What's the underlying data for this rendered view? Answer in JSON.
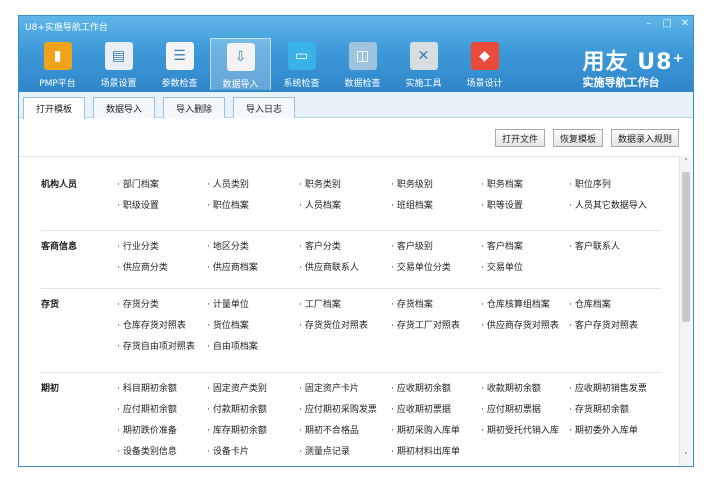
{
  "window": {
    "title": "U8+实施导航工作台",
    "controls": [
      "–",
      "□",
      "✕"
    ]
  },
  "toolbar": [
    {
      "label": "PMP平台",
      "icon": "chart-icon",
      "color": "#f2a11a"
    },
    {
      "label": "场景设置",
      "icon": "film-icon",
      "color": "#e9eef3"
    },
    {
      "label": "参数检查",
      "icon": "checklist-icon",
      "color": "#f4f4f4"
    },
    {
      "label": "数据导入",
      "icon": "excel-import-icon",
      "color": "#f2f2f2",
      "active": true
    },
    {
      "label": "系统检查",
      "icon": "monitor-icon",
      "color": "#39b2e8"
    },
    {
      "label": "数据检查",
      "icon": "database-icon",
      "color": "#9fc4de"
    },
    {
      "label": "实施工具",
      "icon": "tools-icon",
      "color": "#d8dde2"
    },
    {
      "label": "场景设计",
      "icon": "badge-icon",
      "color": "#e94a3a"
    }
  ],
  "brand": {
    "line1": "用友 U8⁺",
    "line2": "实施导航工作台"
  },
  "tabs": [
    {
      "label": "打开模板",
      "active": true
    },
    {
      "label": "数据导入"
    },
    {
      "label": "导入删除"
    },
    {
      "label": "导入日志"
    }
  ],
  "actions": [
    "打开文件",
    "恢复模板",
    "数据录入规则"
  ],
  "categories": [
    {
      "name": "机构人员",
      "rows": [
        [
          "部门档案",
          "人员类别",
          "职务类别",
          "职务级别",
          "职务档案",
          "职位序列"
        ],
        [
          "职级设置",
          "职位档案",
          "人员档案",
          "班组档案",
          "职等设置",
          "人员其它数据导入"
        ]
      ]
    },
    {
      "name": "客商信息",
      "rows": [
        [
          "行业分类",
          "地区分类",
          "客户分类",
          "客户级别",
          "客户档案",
          "客户联系人"
        ],
        [
          "供应商分类",
          "供应商档案",
          "供应商联系人",
          "交易单位分类",
          "交易单位"
        ]
      ]
    },
    {
      "name": "存货",
      "rows": [
        [
          "存货分类",
          "计量单位",
          "工厂档案",
          "存货档案",
          "仓库核算组档案",
          "仓库档案"
        ],
        [
          "仓库存货对照表",
          "货位档案",
          "存货货位对照表",
          "存货工厂对照表",
          "供应商存货对照表",
          "客户存货对照表"
        ],
        [
          "存货自由项对照表",
          "自由项档案"
        ]
      ]
    },
    {
      "name": "期初",
      "rows": [
        [
          "科目期初余额",
          "固定资产类别",
          "固定资产卡片",
          "应收期初余额",
          "收款期初余额",
          "应收期初销售发票"
        ],
        [
          "应付期初余额",
          "付款期初余额",
          "应付期初采购发票",
          "应收期初票据",
          "应付期初票据",
          "存货期初余额"
        ],
        [
          "期初跌价准备",
          "库存期初余额",
          "期初不合格品",
          "期初采购入库单",
          "期初受托代销入库",
          "期初委外入库单"
        ],
        [
          "设备类别信息",
          "设备卡片",
          "测量点记录",
          "期初材料出库单"
        ]
      ]
    }
  ],
  "scrollbar": {
    "up": "˄",
    "down": "˅"
  }
}
